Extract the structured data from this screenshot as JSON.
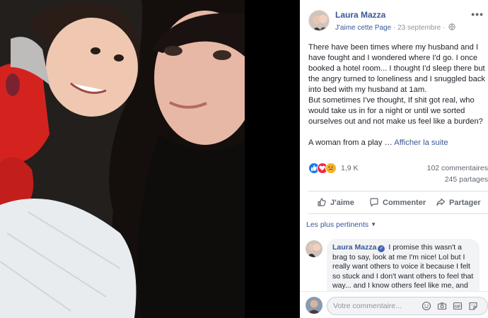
{
  "post": {
    "author": "Laura Mazza",
    "like_page": "J'aime cette Page",
    "separator": "·",
    "date": "23 septembre",
    "separator2": "·",
    "more_icon": "ellipsis-icon",
    "text_p1": "There have been times where my husband and I have fought and I wondered where I'd go. I once booked a hotel room... I thought I'd sleep there but the angry turned to loneliness and I snuggled back into bed with my husband at 1am.",
    "text_p2": "But sometimes I've thought, If shit got real, who would take us in for a night or until we sorted ourselves out and not make us feel like a burden?",
    "text_p3": "A woman from a play …",
    "see_more": "Afficher la suite"
  },
  "stats": {
    "reactions_count": "1,9 K",
    "reactions": [
      "like",
      "love",
      "sad"
    ],
    "comments": "102 commentaires",
    "shares": "245 partages"
  },
  "actions": {
    "like": "J'aime",
    "comment": "Commenter",
    "share": "Partager"
  },
  "comments_filter": {
    "label": "Les plus pertinents"
  },
  "top_comment": {
    "author": "Laura Mazza",
    "text": "I promise this wasn't a brag to say, look at me I'm nice! Lol but I really want others to voice it because I felt so stuck and I don't want others to feel that way... and I know others feel like me, and"
  },
  "composer": {
    "placeholder": "Votre commentaire..."
  },
  "colors": {
    "link": "#385898",
    "like": "#1877f2",
    "love": "#f0284a",
    "sad": "#f7b125"
  }
}
